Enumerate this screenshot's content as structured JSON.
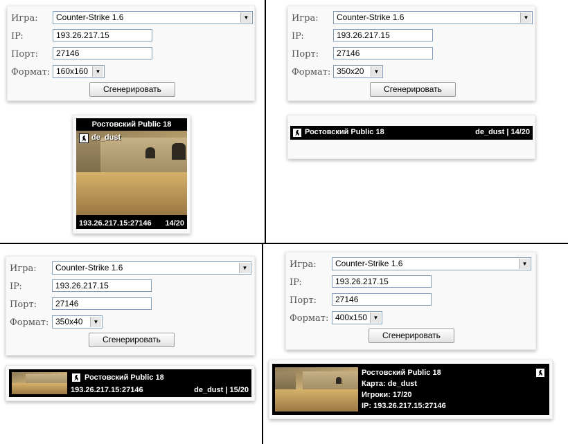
{
  "panels": [
    {
      "form": {
        "game_label": "Игра:",
        "game_value": "Counter-Strike 1.6",
        "ip_label": "IP:",
        "ip_value": "193.26.217.15",
        "port_label": "Порт:",
        "port_value": "27146",
        "format_label": "Формат:",
        "format_value": "160x160",
        "generate_label": "Сгенерировать"
      },
      "banner": {
        "server_name": "Ростовский Public 18",
        "map": "de_dust",
        "address": "193.26.217.15:27146",
        "players": "14/20"
      }
    },
    {
      "form": {
        "game_label": "Игра:",
        "game_value": "Counter-Strike 1.6",
        "ip_label": "IP:",
        "ip_value": "193.26.217.15",
        "port_label": "Порт:",
        "port_value": "27146",
        "format_label": "Формат:",
        "format_value": "350x20",
        "generate_label": "Сгенерировать"
      },
      "banner": {
        "server_name": "Ростовский Public 18",
        "map_players": "de_dust | 14/20"
      }
    },
    {
      "form": {
        "game_label": "Игра:",
        "game_value": "Counter-Strike 1.6",
        "ip_label": "IP:",
        "ip_value": "193.26.217.15",
        "port_label": "Порт:",
        "port_value": "27146",
        "format_label": "Формат:",
        "format_value": "350x40",
        "generate_label": "Сгенерировать"
      },
      "banner": {
        "server_name": "Ростовский Public 18",
        "address": "193.26.217.15:27146",
        "map_players": "de_dust | 15/20"
      }
    },
    {
      "form": {
        "game_label": "Игра:",
        "game_value": "Counter-Strike 1.6",
        "ip_label": "IP:",
        "ip_value": "193.26.217.15",
        "port_label": "Порт:",
        "port_value": "27146",
        "format_label": "Формат:",
        "format_value": "400x150",
        "generate_label": "Сгенерировать"
      },
      "banner": {
        "server_name": "Ростовский Public 18",
        "map_line": "Карта: de_dust",
        "players_line": "Игроки: 17/20",
        "ip_line": "IP: 193.26.217.15:27146"
      }
    }
  ],
  "colors": {
    "divider": "#000000",
    "banner_bg": "#000000",
    "banner_text": "#ffffff"
  },
  "icons": {
    "game_icon": "counter-strike-icon",
    "dropdown": "chevron-down-icon"
  }
}
